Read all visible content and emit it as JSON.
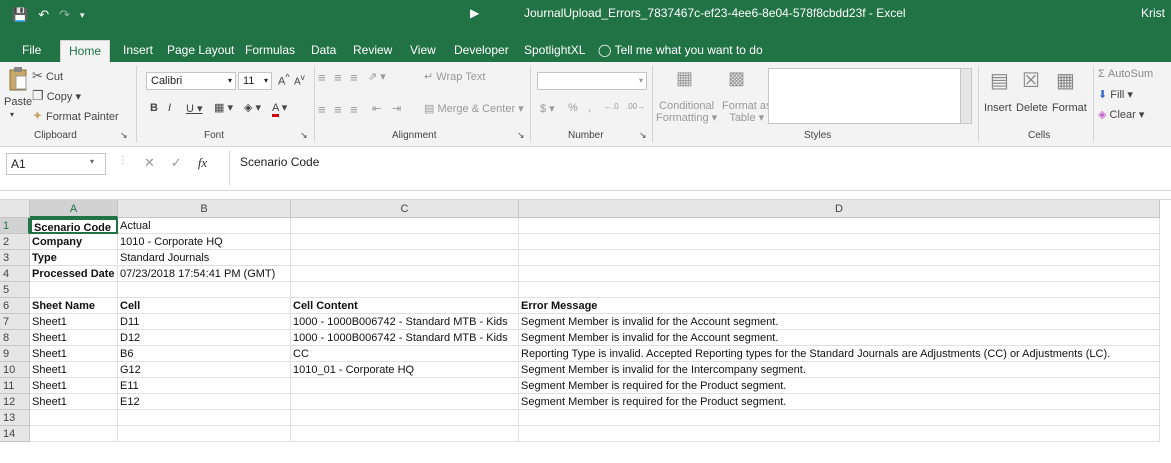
{
  "titlebar": {
    "title": "JournalUpload_Errors_7837467c-ef23-4ee6-8e04-578f8cbdd23f  -  Excel",
    "user": "Krist",
    "icons": [
      "save-icon",
      "undo-icon",
      "redo-icon",
      "customize-icon"
    ]
  },
  "tabs": [
    "File",
    "Home",
    "Insert",
    "Page Layout",
    "Formulas",
    "Data",
    "Review",
    "View",
    "Developer",
    "SpotlightXL",
    "Tell me what you want to do"
  ],
  "ribbon": {
    "clipboard": {
      "paste": "Paste",
      "cut": "Cut",
      "copy": "Copy",
      "format_painter": "Format Painter",
      "label": "Clipboard"
    },
    "font": {
      "font_name": "Calibri",
      "font_size": "11",
      "label": "Font"
    },
    "alignment": {
      "wrap_text": "Wrap Text",
      "merge_center": "Merge & Center",
      "label": "Alignment"
    },
    "number": {
      "format": "",
      "label": "Number"
    },
    "styles": {
      "conditional_1": "Conditional",
      "conditional_2": "Formatting",
      "format_as_1": "Format as",
      "format_as_2": "Table",
      "label": "Styles"
    },
    "cells": {
      "insert": "Insert",
      "delete": "Delete",
      "format": "Format",
      "label": "Cells"
    },
    "editing": {
      "autosum": "AutoSum",
      "fill": "Fill",
      "clear": "Clear"
    }
  },
  "formula_bar": {
    "name_box": "A1",
    "content": "Scenario Code"
  },
  "columns": [
    "A",
    "B",
    "C",
    "D"
  ],
  "rows": [
    {
      "num": "1",
      "cells": [
        "Scenario Code",
        "Actual",
        "",
        ""
      ],
      "bold": [
        true,
        false,
        false,
        false
      ]
    },
    {
      "num": "2",
      "cells": [
        "Company",
        "1010 - Corporate HQ",
        "",
        ""
      ],
      "bold": [
        true,
        false,
        false,
        false
      ]
    },
    {
      "num": "3",
      "cells": [
        "Type",
        "Standard Journals",
        "",
        ""
      ],
      "bold": [
        true,
        false,
        false,
        false
      ]
    },
    {
      "num": "4",
      "cells": [
        "Processed Date",
        "07/23/2018 17:54:41 PM (GMT)",
        "",
        ""
      ],
      "bold": [
        true,
        false,
        false,
        false
      ]
    },
    {
      "num": "5",
      "cells": [
        "",
        "",
        "",
        ""
      ],
      "bold": [
        false,
        false,
        false,
        false
      ]
    },
    {
      "num": "6",
      "cells": [
        "Sheet Name",
        "Cell",
        "Cell Content",
        "Error Message"
      ],
      "bold": [
        true,
        true,
        true,
        true
      ]
    },
    {
      "num": "7",
      "cells": [
        "Sheet1",
        "D11",
        "1000 - 1000B006742 - Standard MTB - Kids",
        "Segment Member is invalid for the Account segment."
      ],
      "bold": [
        false,
        false,
        false,
        false
      ]
    },
    {
      "num": "8",
      "cells": [
        "Sheet1",
        "D12",
        "1000 - 1000B006742 - Standard MTB - Kids",
        "Segment Member is invalid for the Account segment."
      ],
      "bold": [
        false,
        false,
        false,
        false
      ]
    },
    {
      "num": "9",
      "cells": [
        "Sheet1",
        "B6",
        "CC",
        "Reporting Type is invalid.  Accepted Reporting types for the Standard Journals  are Adjustments (CC) or Adjustments (LC)."
      ],
      "bold": [
        false,
        false,
        false,
        false
      ]
    },
    {
      "num": "10",
      "cells": [
        "Sheet1",
        "G12",
        "1010_01 - Corporate HQ",
        "Segment Member is invalid for the Intercompany segment."
      ],
      "bold": [
        false,
        false,
        false,
        false
      ]
    },
    {
      "num": "11",
      "cells": [
        "Sheet1",
        "E11",
        "",
        "Segment Member is required for the Product segment."
      ],
      "bold": [
        false,
        false,
        false,
        false
      ]
    },
    {
      "num": "12",
      "cells": [
        "Sheet1",
        "E12",
        "",
        "Segment Member is required for the Product segment."
      ],
      "bold": [
        false,
        false,
        false,
        false
      ]
    },
    {
      "num": "13",
      "cells": [
        "",
        "",
        "",
        ""
      ],
      "bold": [
        false,
        false,
        false,
        false
      ]
    },
    {
      "num": "14",
      "cells": [
        "",
        "",
        "",
        ""
      ],
      "bold": [
        false,
        false,
        false,
        false
      ]
    }
  ],
  "accent_color": "#217346"
}
